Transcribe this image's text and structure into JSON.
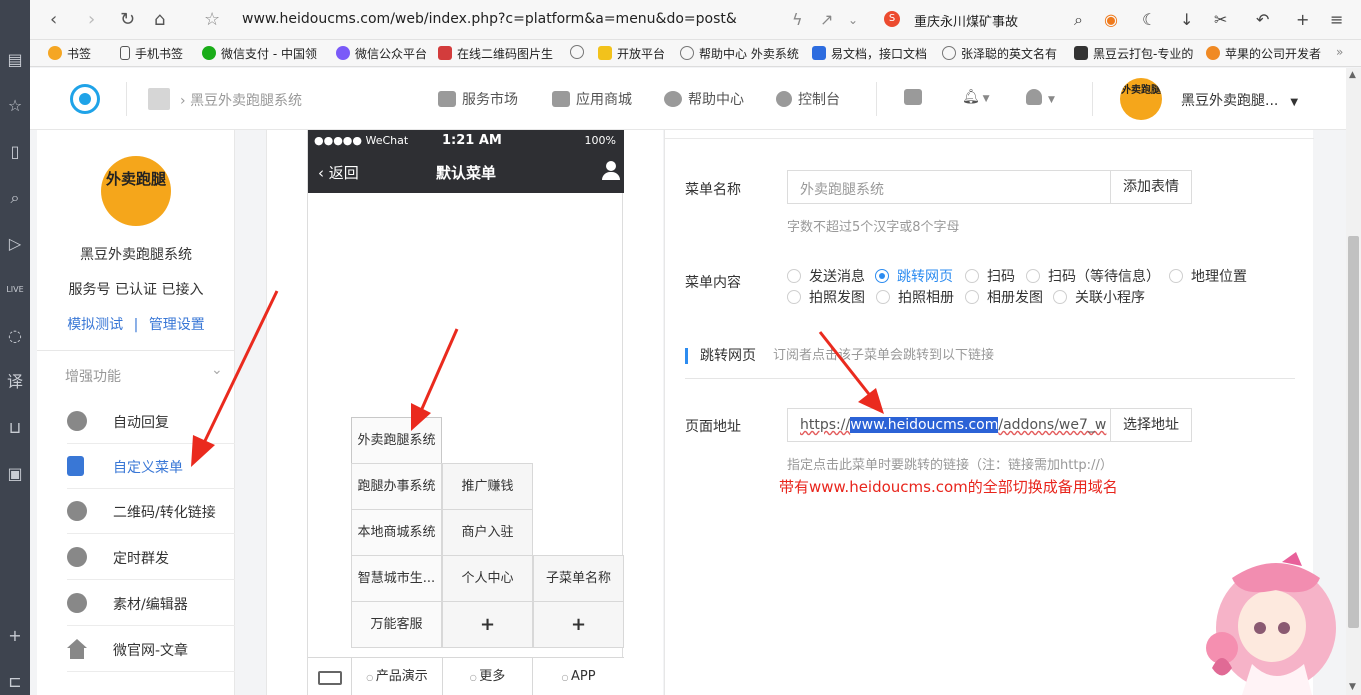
{
  "browser": {
    "url": "www.heidoucms.com/web/index.php?c=platform&a=menu&do=post&",
    "news": "重庆永川煤矿事故",
    "sg_icon": "S",
    "bookmarks": [
      {
        "label": "书签",
        "color": "#f5a623"
      },
      {
        "label": "手机书签",
        "color": "#555555"
      },
      {
        "label": "微信支付 - 中国领",
        "color": "#1aad19"
      },
      {
        "label": "微信公众平台",
        "color": "#7a5af8"
      },
      {
        "label": "在线二维码图片生",
        "color": "#d33c3c"
      },
      {
        "label": "",
        "color": "#777777"
      },
      {
        "label": "开放平台",
        "color": "#f2c21b"
      },
      {
        "label": "帮助中心 外卖系统",
        "color": "#777777"
      },
      {
        "label": "易文档，接口文档",
        "color": "#2d6cdf"
      },
      {
        "label": "张泽聪的英文名有",
        "color": "#777777"
      },
      {
        "label": "黑豆云打包-专业的",
        "color": "#333333"
      },
      {
        "label": "苹果的公司开发者",
        "color": "#f08a24"
      }
    ]
  },
  "header": {
    "crumb": "黑豆外卖跑腿系统",
    "nav": [
      "服务市场",
      "应用商城",
      "帮助中心",
      "控制台"
    ],
    "user_name": "黑豆外卖跑腿...",
    "avatar_text": "外卖跑腿"
  },
  "sidebar": {
    "avatar_text": "外卖跑腿",
    "account_name": "黑豆外卖跑腿系统",
    "account_status": "服务号 已认证 已接入",
    "link_test": "模拟测试",
    "link_sep": "|",
    "link_manage": "管理设置",
    "group_title": "增强功能",
    "items": [
      {
        "label": "自动回复"
      },
      {
        "label": "自定义菜单"
      },
      {
        "label": "二维码/转化链接"
      },
      {
        "label": "定时群发"
      },
      {
        "label": "素材/编辑器"
      },
      {
        "label": "微官网-文章"
      }
    ]
  },
  "phone": {
    "carrier": "●●●●● WeChat",
    "time": "1:21 AM",
    "battery": "100%",
    "back": "返回",
    "title": "默认菜单",
    "col1": [
      "外卖跑腿系统",
      "跑腿办事系统",
      "本地商城系统",
      "智慧城市生...",
      "万能客服"
    ],
    "col2": [
      "推广赚钱",
      "商户入驻",
      "个人中心"
    ],
    "col3": [
      "子菜单名称"
    ],
    "plus": "+",
    "bottom": [
      "产品演示",
      "更多",
      "APP"
    ]
  },
  "form": {
    "name_label": "菜单名称",
    "name_placeholder": "外卖跑腿系统",
    "emoji_button": "添加表情",
    "name_hint": "字数不超过5个汉字或8个字母",
    "content_label": "菜单内容",
    "radios_row1": [
      "发送消息",
      "跳转网页",
      "扫码",
      "扫码（等待信息）",
      "地理位置"
    ],
    "radios_row2": [
      "拍照发图",
      "拍照相册",
      "相册发图",
      "关联小程序"
    ],
    "selected": "跳转网页",
    "section_title": "跳转网页",
    "section_desc": "订阅者点击该子菜单会跳转到以下链接",
    "url_label": "页面地址",
    "url_prefix": "https://",
    "url_highlight": "www.heidoucms.com",
    "url_suffix": "/addons/we7_w",
    "select_url_button": "选择地址",
    "url_hint": "指定点击此菜单时要跳转的链接（注：链接需加http://）",
    "note": "带有www.heidoucms.com的全部切换成备用域名"
  },
  "colors": {
    "accent": "#2d8cf0",
    "link": "#3977d6",
    "annotation": "#e8251c",
    "brand_orange": "#f5a61b"
  }
}
